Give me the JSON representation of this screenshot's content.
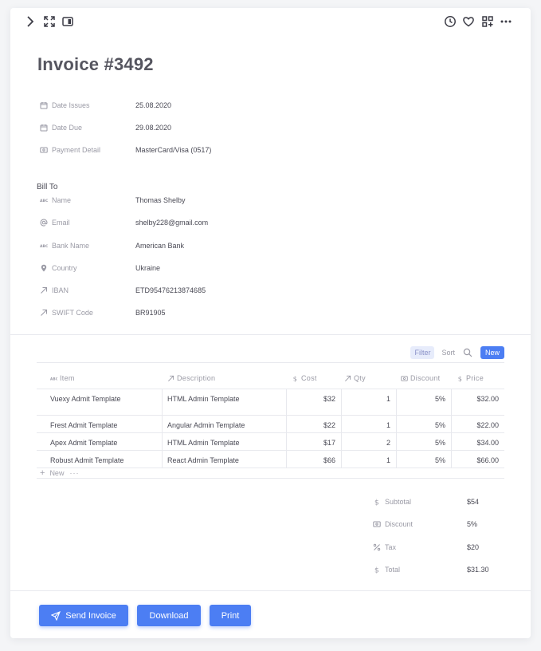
{
  "title": "Invoice #3492",
  "details": [
    {
      "icon": "calendar-icon",
      "label": "Date Issues",
      "value": "25.08.2020"
    },
    {
      "icon": "calendar-icon",
      "label": "Date Due",
      "value": "29.08.2020"
    },
    {
      "icon": "card-icon",
      "label": "Payment Detail",
      "value": "MasterCard/Visa (0517)"
    }
  ],
  "bill_to": {
    "label": "Bill To",
    "fields": [
      {
        "icon": "text-icon",
        "label": "Name",
        "value": "Thomas Shelby"
      },
      {
        "icon": "at-icon",
        "label": "Email",
        "value": "shelby228@gmail.com"
      },
      {
        "icon": "text-icon",
        "label": "Bank Name",
        "value": "American Bank"
      },
      {
        "icon": "location-pin-icon",
        "label": "Country",
        "value": "Ukraine"
      },
      {
        "icon": "arrow-icon",
        "label": "IBAN",
        "value": "ETD95476213874685"
      },
      {
        "icon": "arrow-icon",
        "label": "SWIFT Code",
        "value": "BR91905"
      }
    ]
  },
  "table": {
    "controls": {
      "filter": "Filter",
      "sort": "Sort",
      "new": "New"
    },
    "columns": [
      {
        "icon": "text-icon",
        "label": "Item"
      },
      {
        "icon": "arrow-icon",
        "label": "Description"
      },
      {
        "icon": "dollar-icon",
        "label": "Cost"
      },
      {
        "icon": "arrow-icon",
        "label": "Qty"
      },
      {
        "icon": "card-icon",
        "label": "Discount"
      },
      {
        "icon": "dollar-icon",
        "label": "Price"
      }
    ],
    "rows": [
      {
        "item": "Vuexy Admit Template",
        "description": "HTML Admin Template",
        "cost": "$32",
        "qty": "1",
        "discount": "5%",
        "price": "$32.00"
      },
      {
        "item": "Frest Admit Template",
        "description": "Angular Admin Template",
        "cost": "$22",
        "qty": "1",
        "discount": "5%",
        "price": "$22.00"
      },
      {
        "item": "Apex Admit Template",
        "description": "HTML Admin Template",
        "cost": "$17",
        "qty": "2",
        "discount": "5%",
        "price": "$34.00"
      },
      {
        "item": "Robust Admit Template",
        "description": "React Admin Template",
        "cost": "$66",
        "qty": "1",
        "discount": "5%",
        "price": "$66.00"
      }
    ],
    "new_row_label": "New"
  },
  "totals": [
    {
      "icon": "dollar-icon",
      "label": "Subtotal",
      "value": "$54"
    },
    {
      "icon": "card-icon",
      "label": "Discount",
      "value": "5%"
    },
    {
      "icon": "percent-icon",
      "label": "Tax",
      "value": "$20"
    },
    {
      "icon": "dollar-icon",
      "label": "Total",
      "value": "$31.30"
    }
  ],
  "actions": {
    "send": "Send Invoice",
    "download": "Download",
    "print": "Print"
  },
  "colors": {
    "accent": "#4c7ef3",
    "muted_text": "#9a9aa5",
    "text": "#4a4a55"
  }
}
